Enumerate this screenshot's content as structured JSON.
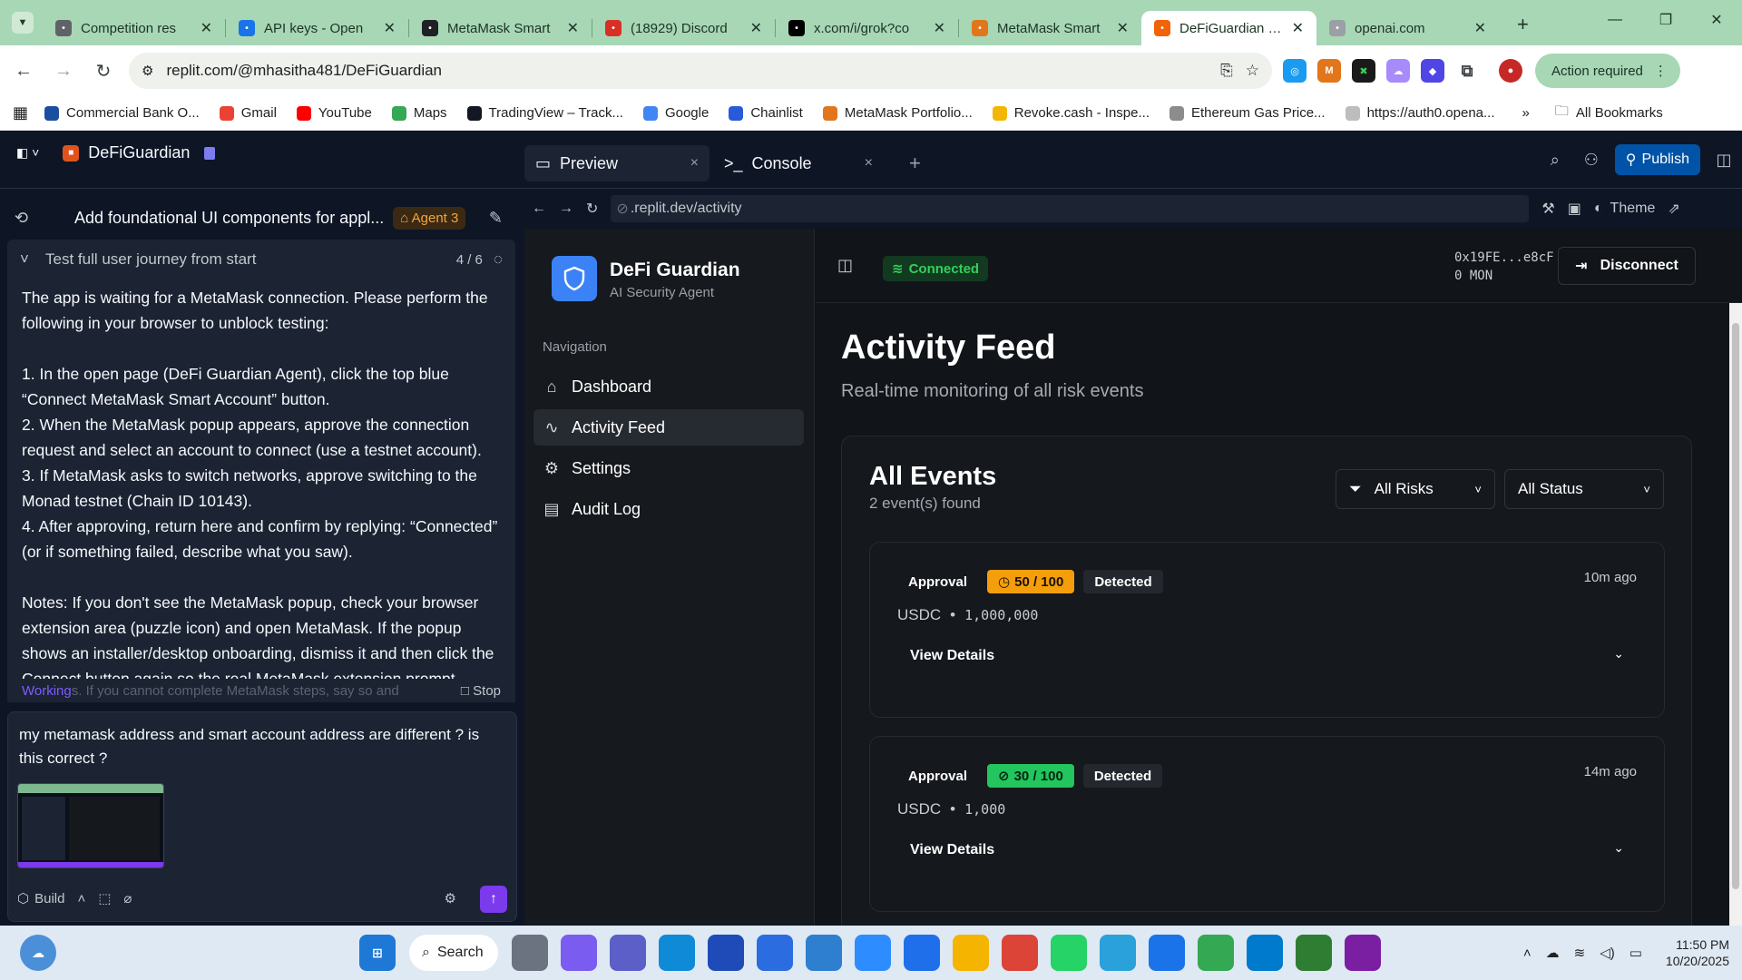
{
  "browser": {
    "tabs": [
      {
        "title": "Competition res",
        "icon": "gear-icon",
        "color": "#5f6368"
      },
      {
        "title": "API keys - Open",
        "icon": "openai-icon",
        "color": "#1a73e8"
      },
      {
        "title": "MetaMask Smart",
        "icon": "metamask-icon",
        "color": "#202124"
      },
      {
        "title": "(18929) Discord",
        "icon": "discord-icon",
        "color": "#d93025"
      },
      {
        "title": "x.com/i/grok?co",
        "icon": "x-icon",
        "color": "#000000"
      },
      {
        "title": "MetaMask Smart",
        "icon": "metamask-icon",
        "color": "#e2761b"
      },
      {
        "title": "DeFiGuardian - F",
        "icon": "replit-icon",
        "color": "#f26207"
      },
      {
        "title": "openai.com",
        "icon": "globe-icon",
        "color": "#9aa0a6"
      }
    ],
    "url": "replit.com/@mhasitha481/DeFiGuardian",
    "action_required": "Action required",
    "bookmarks": [
      {
        "label": "Commercial Bank O...",
        "color": "#1a4fa0"
      },
      {
        "label": "Gmail",
        "color": "#ea4335"
      },
      {
        "label": "YouTube",
        "color": "#ff0000"
      },
      {
        "label": "Maps",
        "color": "#34a853"
      },
      {
        "label": "TradingView – Track...",
        "color": "#131722"
      },
      {
        "label": "Google",
        "color": "#4285f4"
      },
      {
        "label": "Chainlist",
        "color": "#2a5ada"
      },
      {
        "label": "MetaMask Portfolio...",
        "color": "#e2761b"
      },
      {
        "label": "Revoke.cash - Inspe...",
        "color": "#f2b705"
      },
      {
        "label": "Ethereum Gas Price...",
        "color": "#8c8c8c"
      },
      {
        "label": "https://auth0.opena...",
        "color": "#bdbdbd"
      }
    ],
    "all_bookmarks": "All Bookmarks"
  },
  "replit": {
    "project_name": "DeFiGuardian",
    "preview_tab": "Preview",
    "console_tab": "Console",
    "publish": "Publish",
    "chat_title": "Add foundational UI components for appl...",
    "agent_badge": "Agent 3",
    "task_title": "Test full user journey from start",
    "task_progress": "4 / 6",
    "agent_message": [
      "The app is waiting for a MetaMask connection. Please perform the following in your browser to unblock testing:",
      "1. In the open page (DeFi Guardian Agent), click the top blue “Connect MetaMask Smart Account” button.\n2. When the MetaMask popup appears, approve the connection request and select an account to connect (use a testnet account).\n3. If MetaMask asks to switch networks, approve switching to the Monad testnet (Chain ID 10143).\n4. After approving, return here and confirm by replying: “Connected” (or if something failed, describe what you saw).",
      "Notes: If you don't see the MetaMask popup, check your browser extension area (puzzle icon) and open MetaMask. If the popup shows an installer/desktop onboarding, dismiss it and then click the Connect button again so the real MetaMask extension prompt"
    ],
    "working_label": "Working",
    "working_trail": "s. If you cannot complete MetaMask steps, say so and",
    "stop_label": "Stop",
    "user_input": "my metamask address and smart account address are different ? is this correct ?",
    "build_label": "Build",
    "preview_url": ".replit.dev/activity",
    "theme_label": "Theme"
  },
  "site": {
    "brand": "DeFi Guardian",
    "tagline": "AI Security Agent",
    "nav_label": "Navigation",
    "nav": [
      {
        "label": "Dashboard",
        "icon": "home-icon"
      },
      {
        "label": "Activity Feed",
        "icon": "activity-icon",
        "active": true
      },
      {
        "label": "Settings",
        "icon": "gear-icon"
      },
      {
        "label": "Audit Log",
        "icon": "document-icon"
      }
    ],
    "status": "Connected",
    "address": "0x19FE...e8cF",
    "balance": "0 MON",
    "disconnect": "Disconnect",
    "title": "Activity Feed",
    "subtitle": "Real-time monitoring of all risk events",
    "card_title": "All Events",
    "card_count": "2 event(s) found",
    "filter_risk": "All Risks",
    "filter_status": "All Status",
    "events": [
      {
        "type": "Approval",
        "score": "50 / 100",
        "level": "medium",
        "status": "Detected",
        "token": "USDC",
        "amount": "1,000,000",
        "ago": "10m ago",
        "details": "View Details"
      },
      {
        "type": "Approval",
        "score": "30 / 100",
        "level": "low",
        "status": "Detected",
        "token": "USDC",
        "amount": "1,000",
        "ago": "14m ago",
        "details": "View Details"
      }
    ]
  },
  "taskbar": {
    "search": "Search",
    "time": "11:50 PM",
    "date": "10/20/2025",
    "apps": [
      {
        "name": "file-explorer",
        "color": "#6b7280"
      },
      {
        "name": "copilot",
        "color": "#7b5cf0"
      },
      {
        "name": "teams",
        "color": "#5b5fc7"
      },
      {
        "name": "edge",
        "color": "#0f8ad6"
      },
      {
        "name": "azure",
        "color": "#1e4bb8"
      },
      {
        "name": "store",
        "color": "#2b6de0"
      },
      {
        "name": "photos",
        "color": "#2f7fd0"
      },
      {
        "name": "zoom",
        "color": "#2d8cff"
      },
      {
        "name": "k-app",
        "color": "#1f6feb"
      },
      {
        "name": "folder",
        "color": "#f4b400"
      },
      {
        "name": "chrome",
        "color": "#db4437"
      },
      {
        "name": "whatsapp",
        "color": "#25d366"
      },
      {
        "name": "telegram",
        "color": "#2aa1da"
      },
      {
        "name": "chrome-profile",
        "color": "#1a73e8"
      },
      {
        "name": "chrome-h",
        "color": "#34a853"
      },
      {
        "name": "vscode",
        "color": "#007acc"
      },
      {
        "name": "notepad",
        "color": "#2e7d32"
      },
      {
        "name": "chrome-f",
        "color": "#7b1fa2"
      }
    ]
  }
}
